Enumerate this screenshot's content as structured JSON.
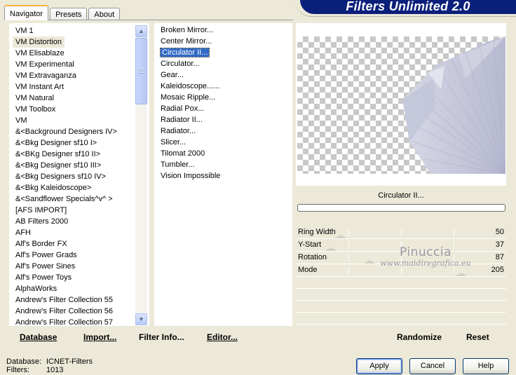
{
  "tabs": [
    {
      "label": "Navigator",
      "active": true
    },
    {
      "label": "Presets",
      "active": false
    },
    {
      "label": "About",
      "active": false
    }
  ],
  "banner": {
    "title": "Filters Unlimited 2.0"
  },
  "categories": {
    "selected": "VM Distortion",
    "items": [
      "VM 1",
      "VM Distortion",
      "VM Elisablaze",
      "VM Experimental",
      "VM Extravaganza",
      "VM Instant Art",
      "VM Natural",
      "VM Toolbox",
      "VM",
      "&<Background Designers IV>",
      "&<Bkg Designer sf10 I>",
      "&<BKg Designer sf10 II>",
      "&<Bkg Designer sf10 III>",
      "&<Bkg Designers sf10 IV>",
      "&<Bkg Kaleidoscope>",
      "&<Sandflower Specials^v^ >",
      "[AFS IMPORT]",
      "AB Filters 2000",
      "AFH",
      "Alf's Border FX",
      "Alf's Power Grads",
      "Alf's Power Sines",
      "Alf's Power Toys",
      "AlphaWorks",
      "Andrew's Filter Collection 55",
      "Andrew's Filter Collection 56",
      "Andrew's Filter Collection 57"
    ]
  },
  "filters": {
    "selected": "Circulator II...",
    "items": [
      "Broken Mirror...",
      "Center Mirror...",
      "Circulator II...",
      "Circulator...",
      "Gear...",
      "Kaleidoscope......",
      "Mosaic Ripple...",
      "Radial Pox...",
      "Radiator II...",
      "Radiator...",
      "Slicer...",
      "Tilomat 2000",
      "Tumbler...",
      "Vision Impossible"
    ]
  },
  "preview": {
    "filter_name": "Circulator II...",
    "progress": 0
  },
  "parameters": [
    {
      "label": "Ring Width",
      "value": 50,
      "max": 255
    },
    {
      "label": "Y-Start",
      "value": 37,
      "max": 255
    },
    {
      "label": "Rotation",
      "value": 87,
      "max": 255
    },
    {
      "label": "Mode",
      "value": 205,
      "max": 255
    }
  ],
  "watermark": {
    "line1": "Pinuccia",
    "line2": "www.maidiregrafica.eu"
  },
  "toolbar": {
    "database": "Database",
    "import": "Import...",
    "filter_info": "Filter Info...",
    "editor": "Editor...",
    "randomize": "Randomize",
    "reset": "Reset"
  },
  "status": {
    "database_label": "Database:",
    "database_value": "ICNET-Filters",
    "filters_label": "Filters:",
    "filters_value": "1013"
  },
  "dialog": {
    "apply": "Apply",
    "cancel": "Cancel",
    "help": "Help"
  },
  "colors": {
    "banner": "#0a1f7a",
    "selection": "#316ac5",
    "face": "#ece9d8",
    "preview_shape": "#c4c6dc"
  }
}
